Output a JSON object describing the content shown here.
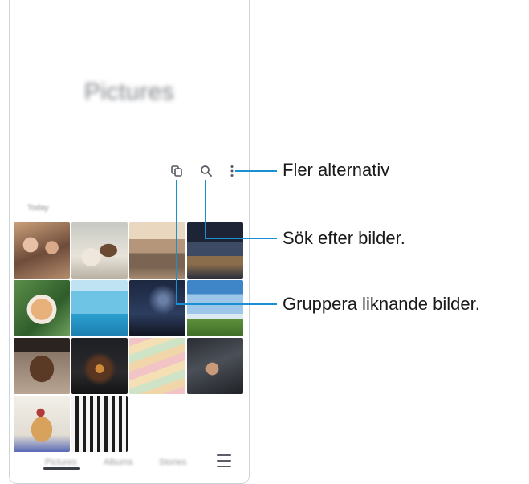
{
  "app": {
    "title": "Pictures"
  },
  "toolbar": {
    "group_icon": "group-similar-icon",
    "search_icon": "search-icon",
    "more_icon": "more-options-icon"
  },
  "section": {
    "label": "Today"
  },
  "grid": {
    "thumbnails": [
      {
        "name": "people-selfie"
      },
      {
        "name": "puppy-and-kitten"
      },
      {
        "name": "town-street"
      },
      {
        "name": "city-night"
      },
      {
        "name": "corgi-dog"
      },
      {
        "name": "sailboat"
      },
      {
        "name": "starry-sky"
      },
      {
        "name": "sky-and-field"
      },
      {
        "name": "chocolate-cake"
      },
      {
        "name": "campfire"
      },
      {
        "name": "macarons"
      },
      {
        "name": "guitar-hands"
      },
      {
        "name": "pancakes"
      },
      {
        "name": "jazz-poster"
      }
    ]
  },
  "bottom_nav": {
    "tabs": [
      "Pictures",
      "Albums",
      "Stories"
    ],
    "menu_icon": "menu-icon"
  },
  "callouts": {
    "more_options": "Fler alternativ",
    "search": "Sök efter bilder.",
    "group_similar": "Gruppera liknande bilder."
  },
  "colors": {
    "callout_line": "#1a8fd1",
    "icon": "#555a62"
  }
}
